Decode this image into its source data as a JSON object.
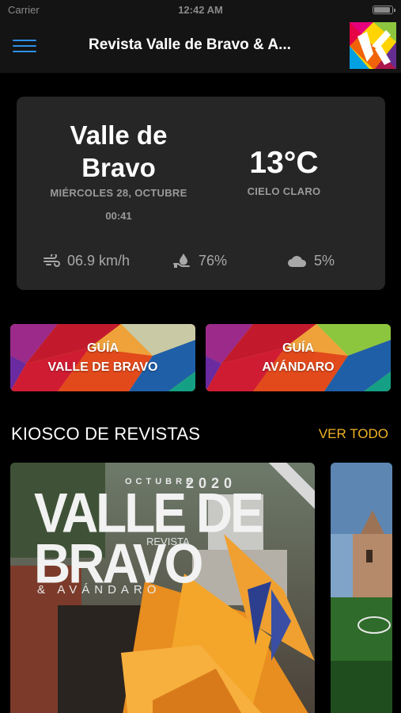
{
  "status_bar": {
    "carrier": "Carrier",
    "time": "12:42 AM"
  },
  "header": {
    "title": "Revista Valle de Bravo & A..."
  },
  "weather": {
    "city": "Valle de Bravo",
    "date": "MIÉRCOLES 28, OCTUBRE",
    "time": "00:41",
    "temperature": "13°C",
    "condition": "CIELO CLARO",
    "wind": "06.9 km/h",
    "humidity": "76%",
    "clouds": "5%"
  },
  "guides": [
    {
      "label_top": "GUÍA",
      "label_bottom": "VALLE DE BRAVO"
    },
    {
      "label_top": "GUÍA",
      "label_bottom": "AVÁNDARO"
    }
  ],
  "kiosk": {
    "title": "KIOSCO DE REVISTAS",
    "see_all": "VER TODO",
    "magazines": [
      {
        "month": "OCTUBRE",
        "year": "2020",
        "title_line1": "VALLE DE",
        "title_line2": "BRAVO",
        "subtitle": "REVISTA",
        "tagline": "& AVÁNDARO"
      }
    ]
  },
  "colors": {
    "accent": "#f0b323",
    "menu": "#2f8fea",
    "card": "#262626",
    "bar": "#141414"
  },
  "icons": [
    "menu-icon",
    "wind-icon",
    "humidity-icon",
    "cloud-icon"
  ]
}
